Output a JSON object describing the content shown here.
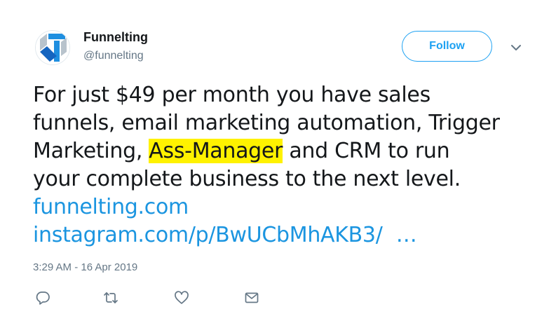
{
  "user": {
    "display_name": "Funnelting",
    "handle": "@funnelting",
    "avatar_icon": "funnelting-logo-icon"
  },
  "follow_button": {
    "label": "Follow"
  },
  "tweet": {
    "text_lines": [
      "For just $49 per month you have sales",
      "funnels, email marketing automation, Trigger",
      "Marketing, ",
      "Ass-Manager",
      " and CRM to run",
      "your complete business to the next level."
    ],
    "links": [
      "funnelting.com",
      "instagram.com/p/BwUCbMhAKB3/",
      " …"
    ],
    "timestamp": "3:29 AM - 16 Apr 2019"
  },
  "actions": {
    "reply_icon": "reply-icon",
    "retweet_icon": "retweet-icon",
    "like_icon": "heart-icon",
    "dm_icon": "envelope-icon"
  },
  "colors": {
    "brand_blue": "#1da1f2",
    "link_blue": "#1b95e0",
    "highlight": "#fff200",
    "muted": "#657786"
  }
}
